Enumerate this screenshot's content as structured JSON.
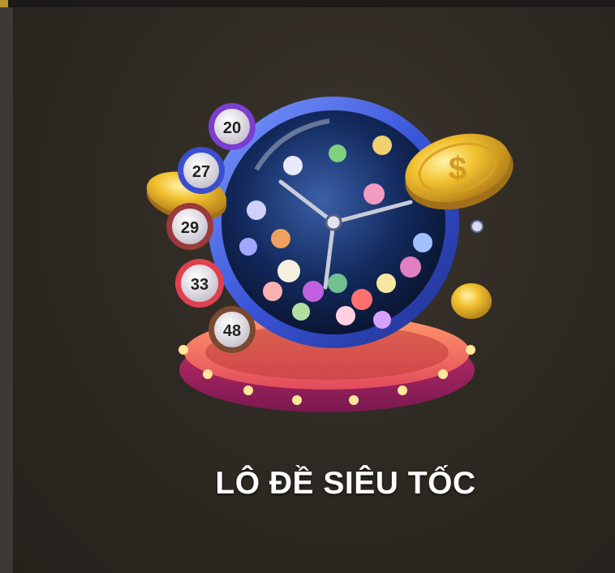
{
  "game": {
    "title": "LÔ ĐỀ SIÊU TỐC",
    "balls": [
      "20",
      "27",
      "29",
      "33",
      "48"
    ],
    "icon": "lottery-drum-icon"
  },
  "colors": {
    "background": "#2a2620",
    "title_text": "#ffffff",
    "drum_rim": "#3a55d8",
    "coin": "#f2c230",
    "stage": "#d4406a"
  }
}
